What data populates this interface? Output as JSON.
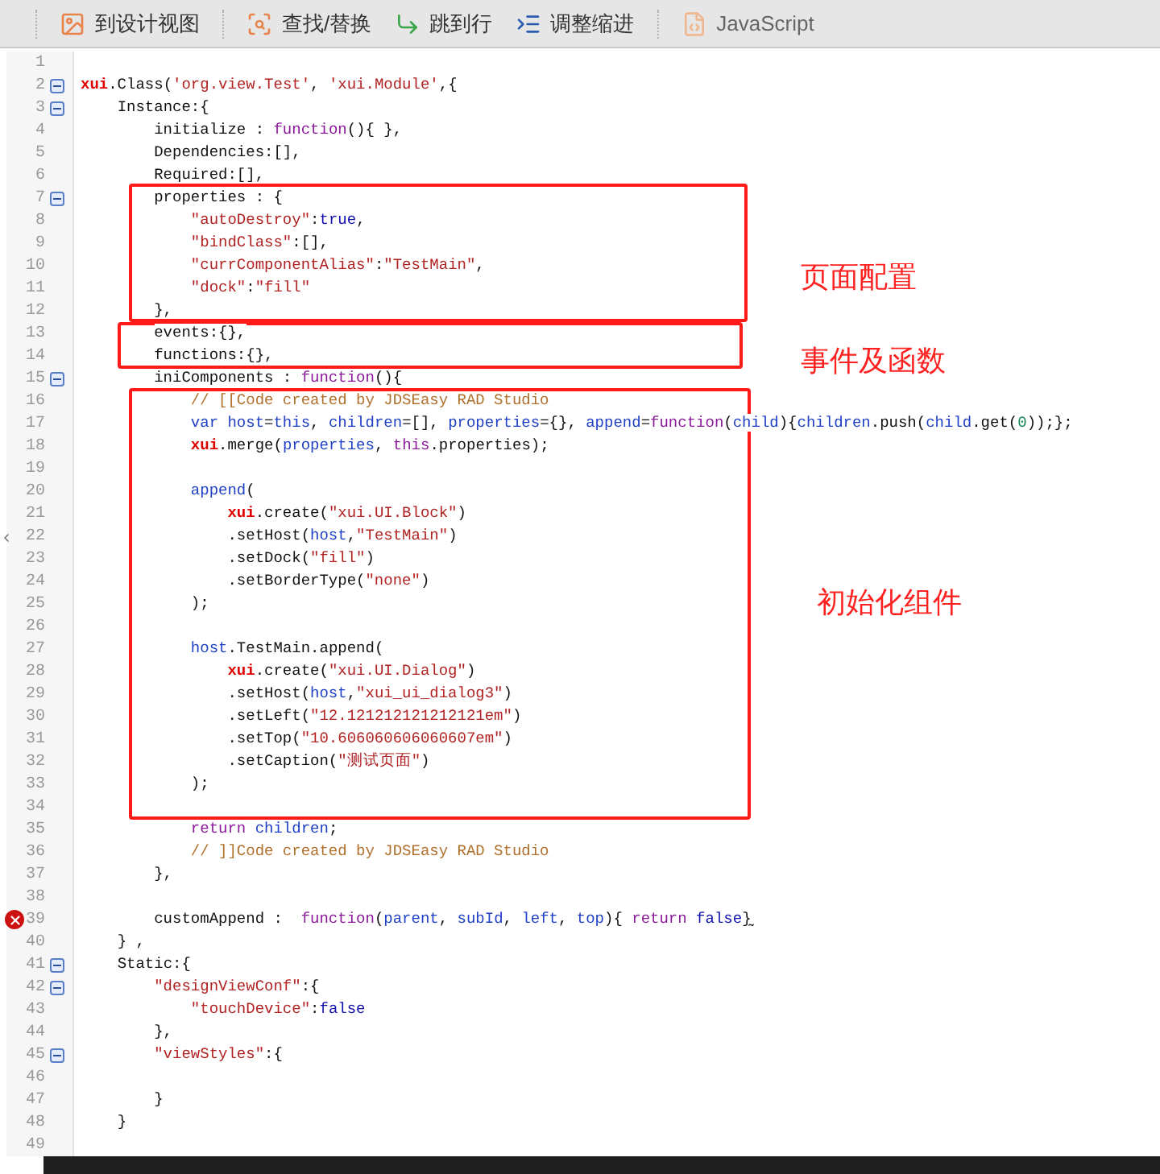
{
  "toolbar": [
    {
      "label": "到设计视图"
    },
    {
      "label": "查找/替换"
    },
    {
      "label": "跳到行"
    },
    {
      "label": "调整缩进"
    },
    {
      "label": "JavaScript"
    }
  ],
  "editor": {
    "lines": [
      {
        "number": "1"
      },
      {
        "number": "2",
        "fold": true,
        "tokens": [
          {
            "kind": "red",
            "text": "xui"
          },
          {
            "kind": "plain",
            "text": ".Class("
          },
          {
            "kind": "str",
            "text": "'org.view.Test'"
          },
          {
            "kind": "plain",
            "text": ", "
          },
          {
            "kind": "str",
            "text": "'xui.Module'"
          },
          {
            "kind": "plain",
            "text": ",{"
          }
        ]
      },
      {
        "number": "3",
        "fold": true,
        "tokens": [
          {
            "kind": "plain",
            "text": "    Instance:{"
          }
        ]
      },
      {
        "number": "4",
        "tokens": [
          {
            "kind": "plain",
            "text": "        initialize : "
          },
          {
            "kind": "kw",
            "text": "function"
          },
          {
            "kind": "plain",
            "text": "(){ },"
          }
        ]
      },
      {
        "number": "5",
        "tokens": [
          {
            "kind": "plain",
            "text": "        Dependencies:[],"
          }
        ]
      },
      {
        "number": "6",
        "tokens": [
          {
            "kind": "plain",
            "text": "        Required:[],"
          }
        ]
      },
      {
        "number": "7",
        "fold": true,
        "tokens": [
          {
            "kind": "plain",
            "text": "        properties : {"
          }
        ]
      },
      {
        "number": "8",
        "tokens": [
          {
            "kind": "str",
            "text": "            \"autoDestroy\""
          },
          {
            "kind": "plain",
            "text": ":"
          },
          {
            "kind": "lit",
            "text": "true"
          },
          {
            "kind": "plain",
            "text": ","
          }
        ]
      },
      {
        "number": "9",
        "tokens": [
          {
            "kind": "str",
            "text": "            \"bindClass\""
          },
          {
            "kind": "plain",
            "text": ":[],"
          }
        ]
      },
      {
        "number": "10",
        "tokens": [
          {
            "kind": "str",
            "text": "            \"currComponentAlias\""
          },
          {
            "kind": "plain",
            "text": ":"
          },
          {
            "kind": "str",
            "text": "\"TestMain\""
          },
          {
            "kind": "plain",
            "text": ","
          }
        ]
      },
      {
        "number": "11",
        "tokens": [
          {
            "kind": "str",
            "text": "            \"dock\""
          },
          {
            "kind": "plain",
            "text": ":"
          },
          {
            "kind": "str",
            "text": "\"fill\""
          }
        ]
      },
      {
        "number": "12",
        "tokens": [
          {
            "kind": "plain",
            "text": "        },"
          }
        ]
      },
      {
        "number": "13",
        "tokens": [
          {
            "kind": "plain",
            "text": "        events:{},"
          }
        ]
      },
      {
        "number": "14",
        "tokens": [
          {
            "kind": "plain",
            "text": "        functions:{},"
          }
        ]
      },
      {
        "number": "15",
        "fold": true,
        "tokens": [
          {
            "kind": "plain",
            "text": "        iniComponents : "
          },
          {
            "kind": "kw",
            "text": "function"
          },
          {
            "kind": "plain",
            "text": "(){"
          }
        ]
      },
      {
        "number": "16",
        "tokens": [
          {
            "kind": "cm",
            "text": "            // [[Code created by JDSEasy RAD Studio"
          }
        ]
      },
      {
        "number": "17",
        "tokens": [
          {
            "kind": "id",
            "text": "            var host"
          },
          {
            "kind": "plain",
            "text": "="
          },
          {
            "kind": "id",
            "text": "this"
          },
          {
            "kind": "plain",
            "text": ", "
          },
          {
            "kind": "id",
            "text": "children"
          },
          {
            "kind": "plain",
            "text": "=[], "
          },
          {
            "kind": "id",
            "text": "properties"
          },
          {
            "kind": "plain",
            "text": "={}, "
          },
          {
            "kind": "id",
            "text": "append"
          },
          {
            "kind": "plain",
            "text": "="
          },
          {
            "kind": "kw",
            "text": "function"
          },
          {
            "kind": "plain",
            "text": "("
          },
          {
            "kind": "id",
            "text": "child"
          },
          {
            "kind": "plain",
            "text": "){"
          },
          {
            "kind": "id",
            "text": "children"
          },
          {
            "kind": "plain",
            "text": ".push("
          },
          {
            "kind": "id",
            "text": "child"
          },
          {
            "kind": "plain",
            "text": ".get("
          },
          {
            "kind": "num",
            "text": "0"
          },
          {
            "kind": "plain",
            "text": "));};"
          }
        ]
      },
      {
        "number": "18",
        "tokens": [
          {
            "kind": "red",
            "text": "            xui"
          },
          {
            "kind": "plain",
            "text": ".merge("
          },
          {
            "kind": "id",
            "text": "properties"
          },
          {
            "kind": "plain",
            "text": ", "
          },
          {
            "kind": "kw",
            "text": "this"
          },
          {
            "kind": "plain",
            "text": ".properties);"
          }
        ]
      },
      {
        "number": "19"
      },
      {
        "number": "20",
        "tokens": [
          {
            "kind": "id",
            "text": "            append"
          },
          {
            "kind": "plain",
            "text": "("
          }
        ]
      },
      {
        "number": "21",
        "tokens": [
          {
            "kind": "red",
            "text": "                xui"
          },
          {
            "kind": "plain",
            "text": ".create("
          },
          {
            "kind": "str",
            "text": "\"xui.UI.Block\""
          },
          {
            "kind": "plain",
            "text": ")"
          }
        ]
      },
      {
        "number": "22",
        "tokens": [
          {
            "kind": "plain",
            "text": "                .setHost("
          },
          {
            "kind": "id",
            "text": "host"
          },
          {
            "kind": "plain",
            "text": ","
          },
          {
            "kind": "str",
            "text": "\"TestMain\""
          },
          {
            "kind": "plain",
            "text": ")"
          }
        ]
      },
      {
        "number": "23",
        "tokens": [
          {
            "kind": "plain",
            "text": "                .setDock("
          },
          {
            "kind": "str",
            "text": "\"fill\""
          },
          {
            "kind": "plain",
            "text": ")"
          }
        ]
      },
      {
        "number": "24",
        "tokens": [
          {
            "kind": "plain",
            "text": "                .setBorderType("
          },
          {
            "kind": "str",
            "text": "\"none\""
          },
          {
            "kind": "plain",
            "text": ")"
          }
        ]
      },
      {
        "number": "25",
        "tokens": [
          {
            "kind": "plain",
            "text": "            );"
          }
        ]
      },
      {
        "number": "26"
      },
      {
        "number": "27",
        "tokens": [
          {
            "kind": "id",
            "text": "            host"
          },
          {
            "kind": "plain",
            "text": ".TestMain.append("
          }
        ]
      },
      {
        "number": "28",
        "tokens": [
          {
            "kind": "red",
            "text": "                xui"
          },
          {
            "kind": "plain",
            "text": ".create("
          },
          {
            "kind": "str",
            "text": "\"xui.UI.Dialog\""
          },
          {
            "kind": "plain",
            "text": ")"
          }
        ]
      },
      {
        "number": "29",
        "tokens": [
          {
            "kind": "plain",
            "text": "                .setHost("
          },
          {
            "kind": "id",
            "text": "host"
          },
          {
            "kind": "plain",
            "text": ","
          },
          {
            "kind": "str",
            "text": "\"xui_ui_dialog3\""
          },
          {
            "kind": "plain",
            "text": ")"
          }
        ]
      },
      {
        "number": "30",
        "tokens": [
          {
            "kind": "plain",
            "text": "                .setLeft("
          },
          {
            "kind": "str",
            "text": "\"12.121212121212121em\""
          },
          {
            "kind": "plain",
            "text": ")"
          }
        ]
      },
      {
        "number": "31",
        "tokens": [
          {
            "kind": "plain",
            "text": "                .setTop("
          },
          {
            "kind": "str",
            "text": "\"10.606060606060607em\""
          },
          {
            "kind": "plain",
            "text": ")"
          }
        ]
      },
      {
        "number": "32",
        "tokens": [
          {
            "kind": "plain",
            "text": "                .setCaption("
          },
          {
            "kind": "str",
            "text": "\"测试页面\""
          },
          {
            "kind": "plain",
            "text": ")"
          }
        ]
      },
      {
        "number": "33",
        "tokens": [
          {
            "kind": "plain",
            "text": "            );"
          }
        ]
      },
      {
        "number": "34"
      },
      {
        "number": "35",
        "tokens": [
          {
            "kind": "kw",
            "text": "            return "
          },
          {
            "kind": "id",
            "text": "children"
          },
          {
            "kind": "plain",
            "text": ";"
          }
        ]
      },
      {
        "number": "36",
        "tokens": [
          {
            "kind": "cm",
            "text": "            // ]]Code created by JDSEasy RAD Studio"
          }
        ]
      },
      {
        "number": "37",
        "tokens": [
          {
            "kind": "plain",
            "text": "        },"
          }
        ]
      },
      {
        "number": "38"
      },
      {
        "number": "39",
        "error": true,
        "tokens": [
          {
            "kind": "plain",
            "text": "        customAppend :  "
          },
          {
            "kind": "kw",
            "text": "function"
          },
          {
            "kind": "plain",
            "text": "("
          },
          {
            "kind": "id",
            "text": "parent"
          },
          {
            "kind": "plain",
            "text": ", "
          },
          {
            "kind": "id",
            "text": "subId"
          },
          {
            "kind": "plain",
            "text": ", "
          },
          {
            "kind": "id",
            "text": "left"
          },
          {
            "kind": "plain",
            "text": ", "
          },
          {
            "kind": "id",
            "text": "top"
          },
          {
            "kind": "plain",
            "text": "){ "
          },
          {
            "kind": "kw",
            "text": "return "
          },
          {
            "kind": "lit",
            "text": "false"
          },
          {
            "kind": "plain",
            "text": "}"
          }
        ]
      },
      {
        "number": "40",
        "tokens": [
          {
            "kind": "plain",
            "text": "    } ,"
          }
        ]
      },
      {
        "number": "41",
        "fold": true,
        "tokens": [
          {
            "kind": "plain",
            "text": "    Static:{"
          }
        ]
      },
      {
        "number": "42",
        "fold": true,
        "tokens": [
          {
            "kind": "str",
            "text": "        \"designViewConf\""
          },
          {
            "kind": "plain",
            "text": ":{"
          }
        ]
      },
      {
        "number": "43",
        "tokens": [
          {
            "kind": "str",
            "text": "            \"touchDevice\""
          },
          {
            "kind": "plain",
            "text": ":"
          },
          {
            "kind": "lit",
            "text": "false"
          }
        ]
      },
      {
        "number": "44",
        "tokens": [
          {
            "kind": "plain",
            "text": "        },"
          }
        ]
      },
      {
        "number": "45",
        "fold": true,
        "tokens": [
          {
            "kind": "str",
            "text": "        \"viewStyles\""
          },
          {
            "kind": "plain",
            "text": ":{"
          }
        ]
      },
      {
        "number": "46"
      },
      {
        "number": "47",
        "tokens": [
          {
            "kind": "plain",
            "text": "        }"
          }
        ]
      },
      {
        "number": "48",
        "tokens": [
          {
            "kind": "plain",
            "text": "    }"
          }
        ]
      },
      {
        "number": "49"
      }
    ]
  },
  "annotations": [
    {
      "label": "页面配置"
    },
    {
      "label": "事件及函数"
    },
    {
      "label": "初始化组件"
    }
  ]
}
